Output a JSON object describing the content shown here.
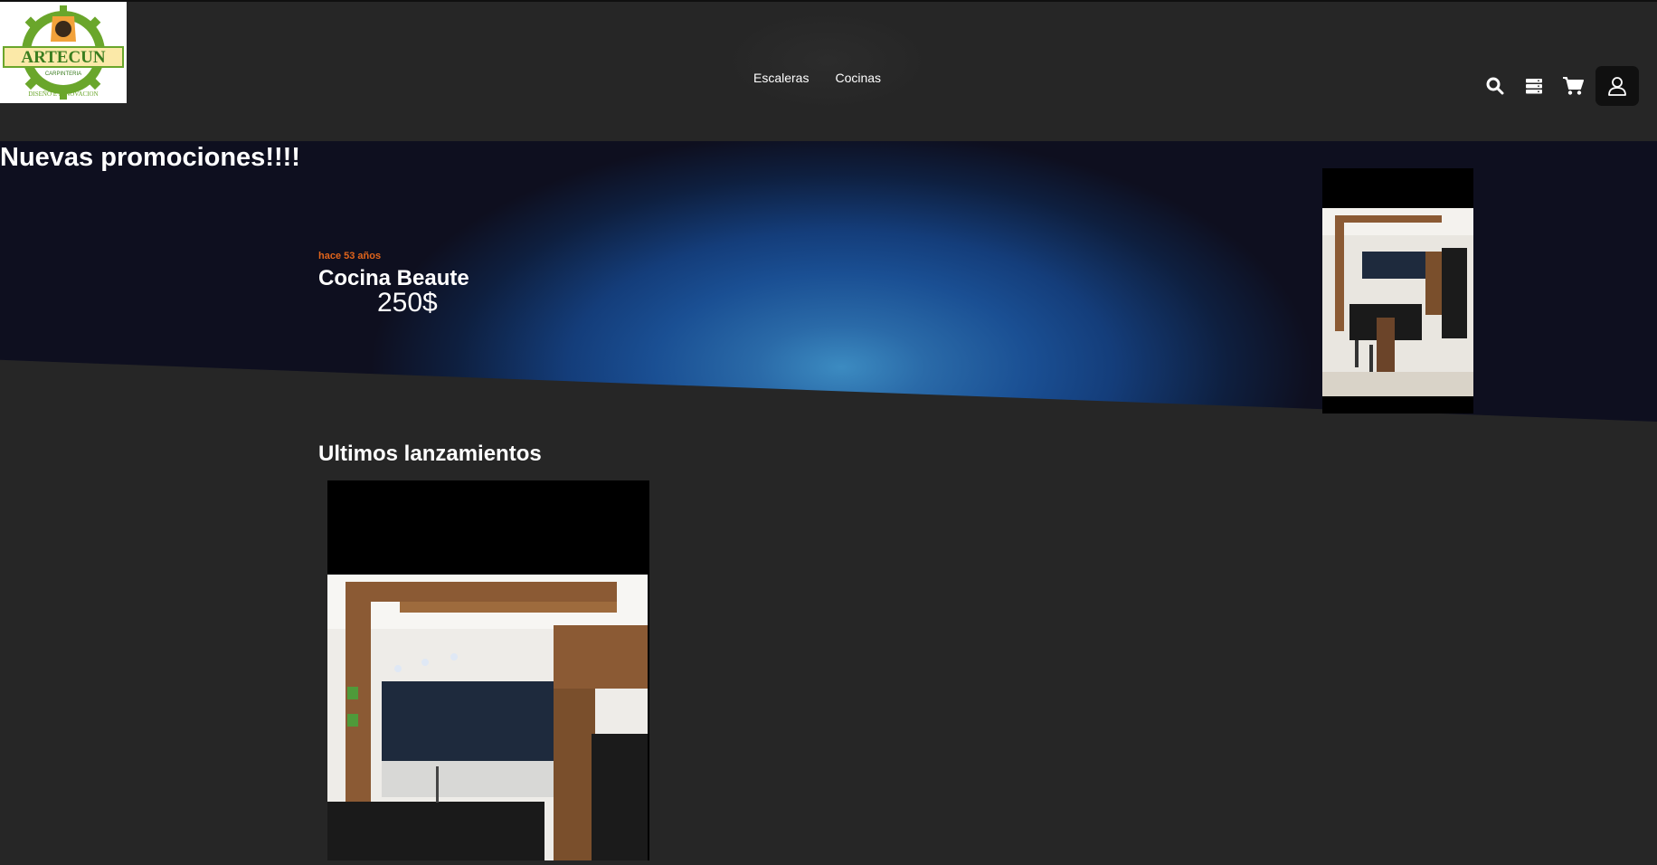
{
  "logo": {
    "brand": "ARTECUN",
    "sub": "CARPINTERIA",
    "tagline": "DISEÑO E INNOVACION"
  },
  "nav": {
    "items": [
      {
        "label": "Escaleras"
      },
      {
        "label": "Cocinas"
      }
    ]
  },
  "header_icons": [
    "search-icon",
    "server-icon",
    "cart-icon",
    "user-icon"
  ],
  "hero": {
    "title": "Nuevas promociones!!!!",
    "promo": {
      "date": "hace 53 años",
      "name": "Cocina Beaute",
      "price": "250$"
    }
  },
  "latest": {
    "title": "Ultimos lanzamientos"
  },
  "colors": {
    "accent": "#e0641b",
    "background": "#262626",
    "hero_blue": "#1a4f93"
  }
}
